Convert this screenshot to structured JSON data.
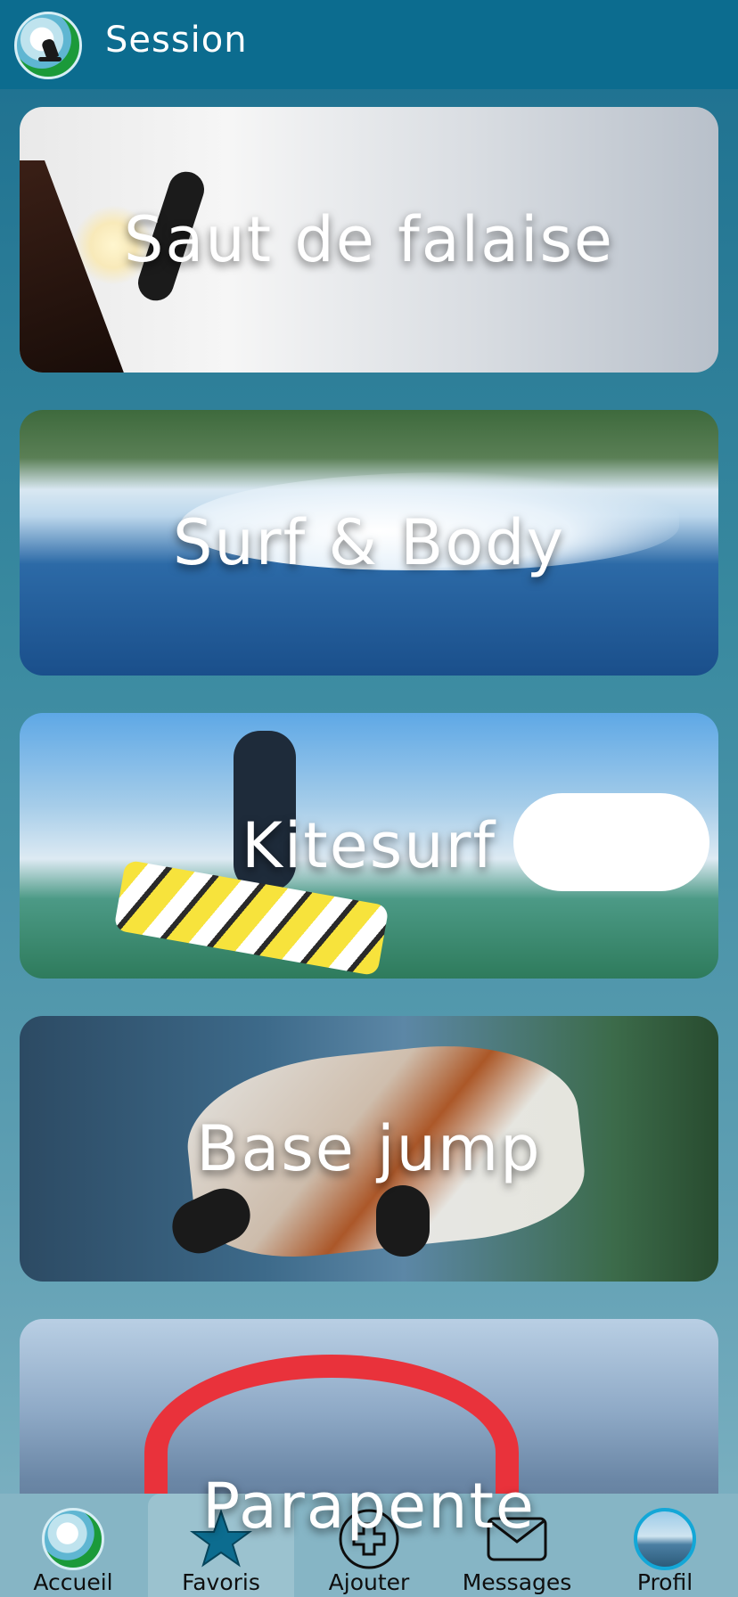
{
  "header": {
    "title": "Session",
    "logo_icon": "kitesurf-logo-icon"
  },
  "categories": [
    {
      "label": "Saut de falaise"
    },
    {
      "label": "Surf & Body"
    },
    {
      "label": "Kitesurf"
    },
    {
      "label": "Base jump"
    },
    {
      "label": "Parapente"
    }
  ],
  "nav": {
    "items": [
      {
        "label": "Accueil",
        "icon": "home-logo-icon"
      },
      {
        "label": "Favoris",
        "icon": "star-icon",
        "active": true
      },
      {
        "label": "Ajouter",
        "icon": "plus-circle-icon"
      },
      {
        "label": "Messages",
        "icon": "mail-icon"
      },
      {
        "label": "Profil",
        "icon": "avatar"
      }
    ]
  },
  "colors": {
    "header": "#0c6c8f",
    "nav_bg": "#86b5c5",
    "star": "#0c6c8f"
  }
}
